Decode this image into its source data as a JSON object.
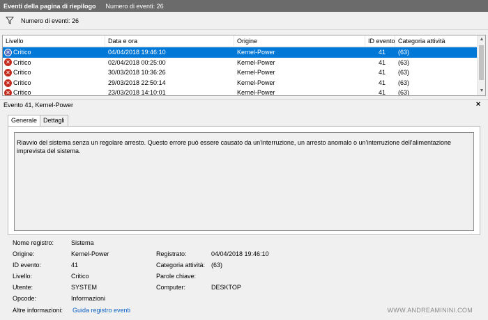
{
  "titlebar": {
    "title": "Eventi della pagina di riepilogo",
    "count": "Numero di eventi: 26"
  },
  "filterbar": {
    "icon": "filter-icon",
    "count": "Numero di eventi: 26"
  },
  "grid": {
    "columns": [
      "Livello",
      "Data e ora",
      "Origine",
      "ID evento",
      "Categoria attività"
    ],
    "rows": [
      {
        "level": "Critico",
        "date": "04/04/2018 19:46:10",
        "source": "Kernel-Power",
        "id": "41",
        "category": "(63)",
        "selected": true
      },
      {
        "level": "Critico",
        "date": "02/04/2018 00:25:00",
        "source": "Kernel-Power",
        "id": "41",
        "category": "(63)",
        "selected": false
      },
      {
        "level": "Critico",
        "date": "30/03/2018 10:36:26",
        "source": "Kernel-Power",
        "id": "41",
        "category": "(63)",
        "selected": false
      },
      {
        "level": "Critico",
        "date": "29/03/2018 22:50:14",
        "source": "Kernel-Power",
        "id": "41",
        "category": "(63)",
        "selected": false
      },
      {
        "level": "Critico",
        "date": "23/03/2018 14:10:01",
        "source": "Kernel-Power",
        "id": "41",
        "category": "(63)",
        "selected": false
      }
    ]
  },
  "panel": {
    "title": "Evento 41, Kernel-Power",
    "close": "×",
    "tabs": [
      "Generale",
      "Dettagli"
    ],
    "description": "Riavvio del sistema senza un regolare arresto. Questo errore può essere causato da un'interruzione, un arresto anomalo o un'interruzione dell'alimentazione imprevista del sistema."
  },
  "details": {
    "log_name_label": "Nome registro:",
    "log_name": "Sistema",
    "source_label": "Origine:",
    "source": "Kernel-Power",
    "logged_label": "Registrato:",
    "logged": "04/04/2018 19:46:10",
    "event_id_label": "ID evento:",
    "event_id": "41",
    "task_label": "Categoria attività:",
    "task": "(63)",
    "level_label": "Livello:",
    "level": "Critico",
    "keywords_label": "Parole chiave:",
    "keywords": "",
    "user_label": "Utente:",
    "user": "SYSTEM",
    "computer_label": "Computer:",
    "computer": "DESKTOP",
    "opcode_label": "Opcode:",
    "opcode": "Informazioni",
    "more_info_label": "Altre informazioni:",
    "more_info_link": "Guida registro eventi"
  },
  "watermark": "WWW.ANDREAMININI.COM"
}
